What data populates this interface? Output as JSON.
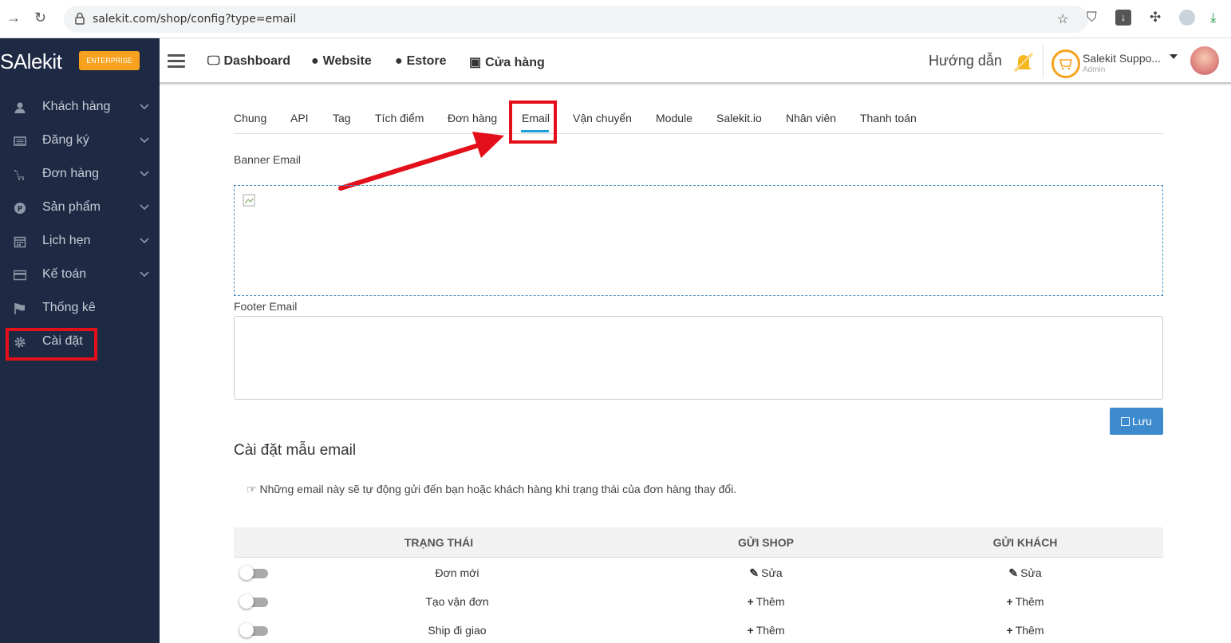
{
  "browser": {
    "url": "salekit.com/shop/config?type=email"
  },
  "sidebar": {
    "logo": "SAlekit",
    "badge": "ENTERPRISE",
    "items": [
      {
        "label": "Khách hàng",
        "icon": "user-icon",
        "has_chevron": true
      },
      {
        "label": "Đăng ký",
        "icon": "list-icon",
        "has_chevron": true
      },
      {
        "label": "Đơn hàng",
        "icon": "cart-icon",
        "has_chevron": true
      },
      {
        "label": "Sản phẩm",
        "icon": "product-icon",
        "has_chevron": true
      },
      {
        "label": "Lịch hẹn",
        "icon": "calendar-icon",
        "has_chevron": true
      },
      {
        "label": "Kế toán",
        "icon": "credit-card-icon",
        "has_chevron": true
      },
      {
        "label": "Thống kê",
        "icon": "flag-icon",
        "has_chevron": false
      },
      {
        "label": "Cài đặt",
        "icon": "gear-icon",
        "has_chevron": false
      }
    ]
  },
  "header": {
    "nav": [
      {
        "label": "Dashboard",
        "icon": "monitor-icon"
      },
      {
        "label": "Website",
        "icon": "globe-icon"
      },
      {
        "label": "Estore",
        "icon": "globe-icon"
      },
      {
        "label": "Cửa hàng",
        "icon": "store-icon"
      }
    ],
    "help": "Hướng dẫn",
    "user_name": "Salekit Suppo...",
    "user_role": "Admin"
  },
  "tabs": [
    "Chung",
    "API",
    "Tag",
    "Tích điểm",
    "Đơn hàng",
    "Email",
    "Vận chuyển",
    "Module",
    "Salekit.io",
    "Nhân viên",
    "Thanh toán"
  ],
  "active_tab": "Email",
  "form": {
    "banner_label": "Banner Email",
    "footer_label": "Footer Email",
    "footer_value": "",
    "save_label": "Lưu"
  },
  "templates": {
    "title": "Cài đặt mẫu email",
    "note": "Những email này sẽ tự động gửi đến bạn hoặc khách hàng khi trạng thái của đơn hàng thay đổi.",
    "columns": [
      "TRẠNG THÁI",
      "GỬI SHOP",
      "GỬI KHÁCH"
    ],
    "rows": [
      {
        "status": "Đơn mới",
        "enabled": false,
        "shop": {
          "icon": "edit-icon",
          "label": "Sửa"
        },
        "customer": {
          "icon": "edit-icon",
          "label": "Sửa"
        }
      },
      {
        "status": "Tạo vận đơn",
        "enabled": false,
        "shop": {
          "icon": "plus-icon",
          "label": "Thêm"
        },
        "customer": {
          "icon": "plus-icon",
          "label": "Thêm"
        }
      },
      {
        "status": "Ship đi giao",
        "enabled": false,
        "shop": {
          "icon": "plus-icon",
          "label": "Thêm"
        },
        "customer": {
          "icon": "plus-icon",
          "label": "Thêm"
        }
      }
    ]
  },
  "colors": {
    "sidebar_bg": "#1e2a44",
    "accent_blue": "#3d8bcd",
    "tab_underline": "#1da1dc",
    "highlight_red": "#e3101b",
    "badge_orange": "#f6a21e"
  }
}
